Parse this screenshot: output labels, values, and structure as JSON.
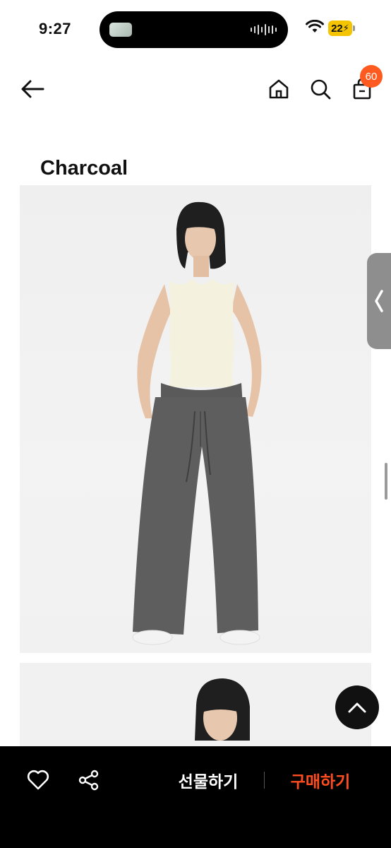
{
  "status_bar": {
    "time": "9:27",
    "battery": "22"
  },
  "product": {
    "color_title": "Charcoal"
  },
  "nav": {
    "cart_count": "60"
  },
  "bottom": {
    "gift_label": "선물하기",
    "buy_label": "구매하기"
  },
  "colors": {
    "accent": "#ff5a1f",
    "buy": "#ff4d1f",
    "bar": "#000000"
  },
  "icons": [
    "back-arrow-icon",
    "home-icon",
    "search-icon",
    "shopping-bag-icon",
    "heart-icon",
    "share-icon",
    "chevron-up-icon",
    "chevron-left-icon"
  ]
}
